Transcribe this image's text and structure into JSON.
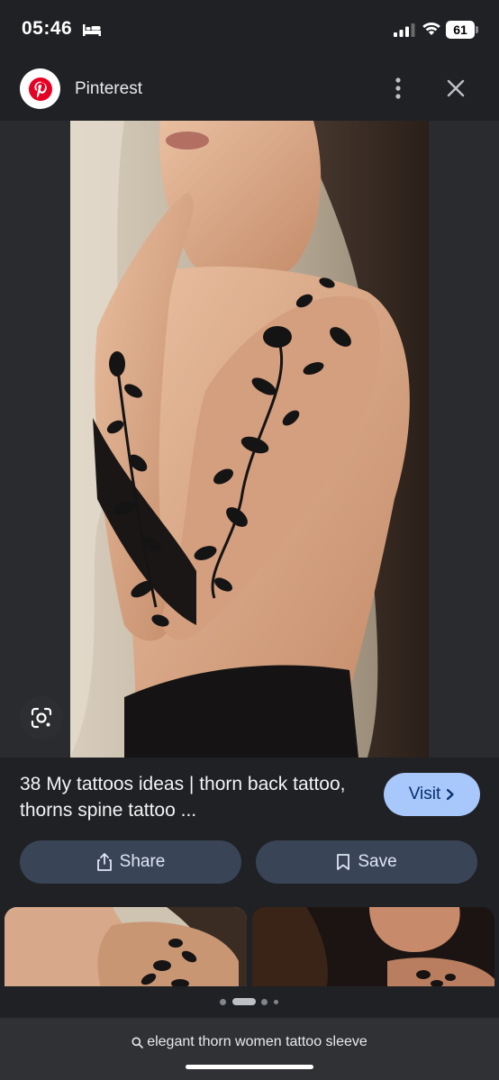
{
  "status_bar": {
    "time": "05:46",
    "battery": "61"
  },
  "header": {
    "site_name": "Pinterest",
    "logo_icon": "pinterest-logo",
    "menu_icon": "more-vert-icon",
    "close_icon": "close-icon"
  },
  "result": {
    "title": "38 My tattoos ideas | thorn back tattoo, thorns spine tattoo ...",
    "visit_label": "Visit"
  },
  "actions": {
    "share_label": "Share",
    "save_label": "Save"
  },
  "pagination": {
    "active_index": 1,
    "count": 4
  },
  "search": {
    "query": "elegant thorn women tattoo sleeve"
  },
  "colors": {
    "background": "#202124",
    "visit_bg": "#a8c7fa",
    "action_bg": "#394457",
    "pinterest_red": "#e60023"
  }
}
